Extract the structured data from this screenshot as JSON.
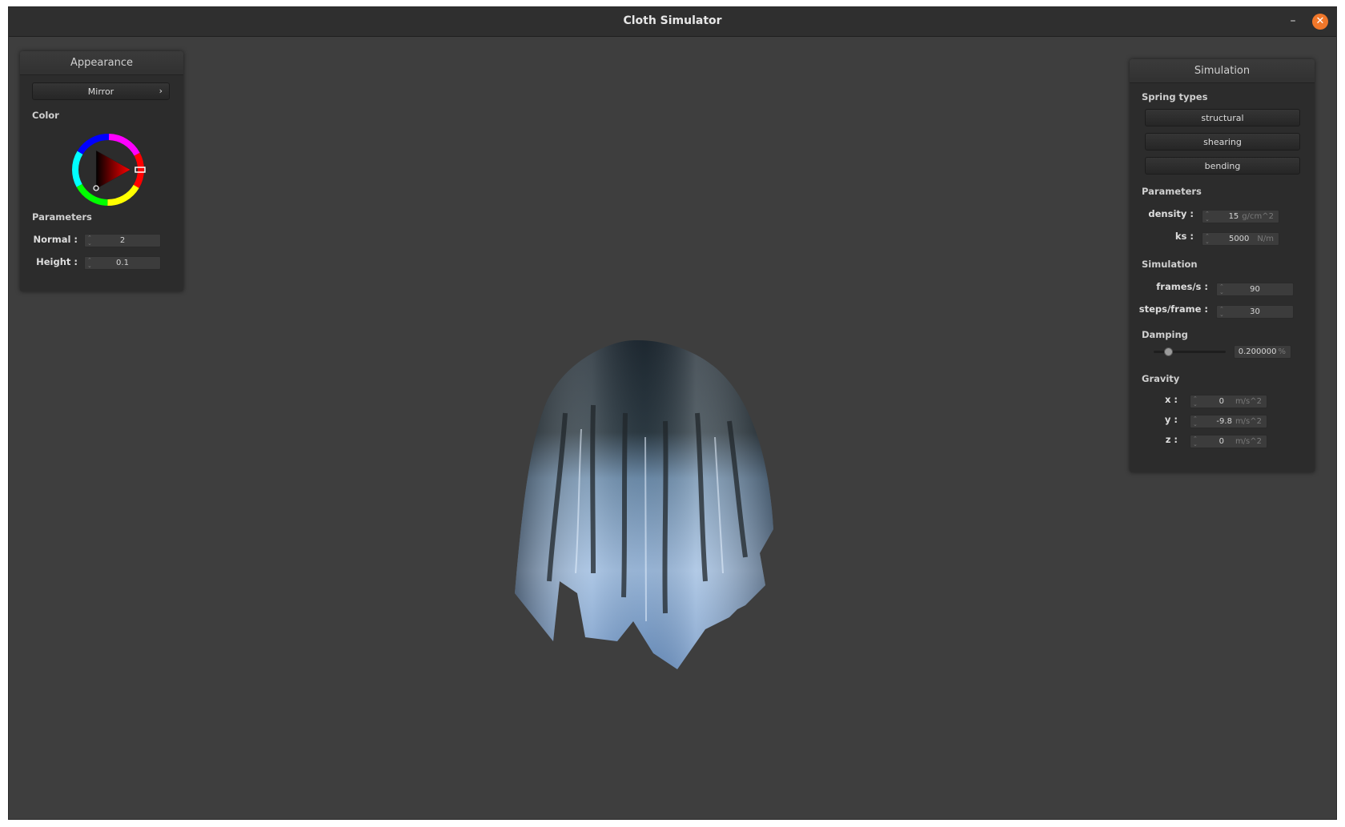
{
  "window": {
    "title": "Cloth Simulator"
  },
  "appearance": {
    "header": "Appearance",
    "shader_select": "Mirror",
    "shader_chevron": "›",
    "color_label": "Color",
    "params_label": "Parameters",
    "normal_label": "Normal :",
    "normal_value": "2",
    "height_label": "Height :",
    "height_value": "0.1"
  },
  "simulation": {
    "header": "Simulation",
    "spring_types_label": "Spring types",
    "spring_buttons": [
      "structural",
      "shearing",
      "bending"
    ],
    "params_label": "Parameters",
    "density_label": "density :",
    "density_value": "15",
    "density_unit": "g/cm^2",
    "ks_label": "ks :",
    "ks_value": "5000",
    "ks_unit": "N/m",
    "sim_label": "Simulation",
    "fps_label": "frames/s :",
    "fps_value": "90",
    "steps_label": "steps/frame :",
    "steps_value": "30",
    "damping_label": "Damping",
    "damping_value": "0.200000",
    "damping_unit": "%",
    "damping_fraction": 0.2,
    "gravity_label": "Gravity",
    "gx_label": "x :",
    "gx_value": "0",
    "gy_label": "y :",
    "gy_value": "-9.8",
    "gz_label": "z :",
    "gz_value": "0",
    "gravity_unit": "m/s^2"
  },
  "colors": {
    "background": "#3e3e3e",
    "panel": "#2c2c2c",
    "close_button": "#f0772a",
    "selected_color": "#ff0000"
  },
  "icons": {
    "minimize": "minimize-icon",
    "close": "close-icon",
    "spinner": "spinner-arrows-icon"
  }
}
